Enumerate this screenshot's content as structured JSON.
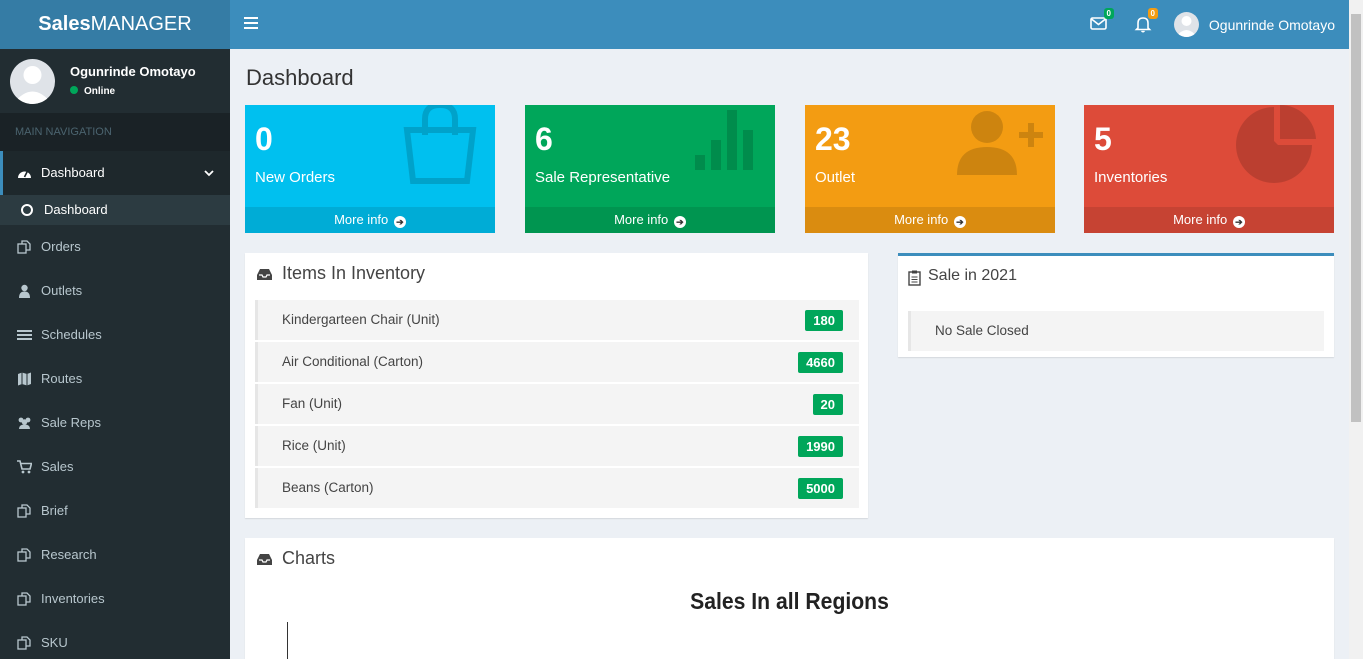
{
  "brand": {
    "bold": "Sales",
    "light": "MANAGER"
  },
  "header": {
    "messages_count": "0",
    "notifications_count": "0",
    "user_name": "Ogunrinde Omotayo"
  },
  "sidebar": {
    "user_name": "Ogunrinde Omotayo",
    "status": "Online",
    "section_label": "MAIN NAVIGATION",
    "items": [
      {
        "label": "Dashboard",
        "icon": "dashboard-icon"
      },
      {
        "label": "Dashboard",
        "icon": "circle-icon"
      },
      {
        "label": "Orders",
        "icon": "copy-icon"
      },
      {
        "label": "Outlets",
        "icon": "user-icon"
      },
      {
        "label": "Schedules",
        "icon": "list-icon"
      },
      {
        "label": "Routes",
        "icon": "map-icon"
      },
      {
        "label": "Sale Reps",
        "icon": "users-icon"
      },
      {
        "label": "Sales",
        "icon": "cart-icon"
      },
      {
        "label": "Brief",
        "icon": "copy-icon"
      },
      {
        "label": "Research",
        "icon": "copy-icon"
      },
      {
        "label": "Inventories",
        "icon": "copy-icon"
      },
      {
        "label": "SKU",
        "icon": "copy-icon"
      }
    ]
  },
  "page_title": "Dashboard",
  "stats": [
    {
      "value": "0",
      "label": "New Orders",
      "more": "More info",
      "color": "#00c0ef",
      "icon": "shopping-bag-icon"
    },
    {
      "value": "6",
      "label": "Sale Representative",
      "more": "More info",
      "color": "#00a65a",
      "icon": "bar-chart-icon"
    },
    {
      "value": "23",
      "label": "Outlet",
      "more": "More info",
      "color": "#f39c12",
      "icon": "user-plus-icon"
    },
    {
      "value": "5",
      "label": "Inventories",
      "more": "More info",
      "color": "#dd4b39",
      "icon": "pie-chart-icon"
    }
  ],
  "inventory": {
    "title": "Items In Inventory",
    "items": [
      {
        "name": "Kindergarteen Chair (Unit)",
        "qty": "180"
      },
      {
        "name": "Air Conditional (Carton)",
        "qty": "4660"
      },
      {
        "name": "Fan (Unit)",
        "qty": "20"
      },
      {
        "name": "Rice (Unit)",
        "qty": "1990"
      },
      {
        "name": "Beans (Carton)",
        "qty": "5000"
      }
    ]
  },
  "sales": {
    "title": "Sale in 2021",
    "message": "No Sale Closed"
  },
  "charts": {
    "title": "Charts",
    "chart_title": "Sales In all Regions"
  }
}
